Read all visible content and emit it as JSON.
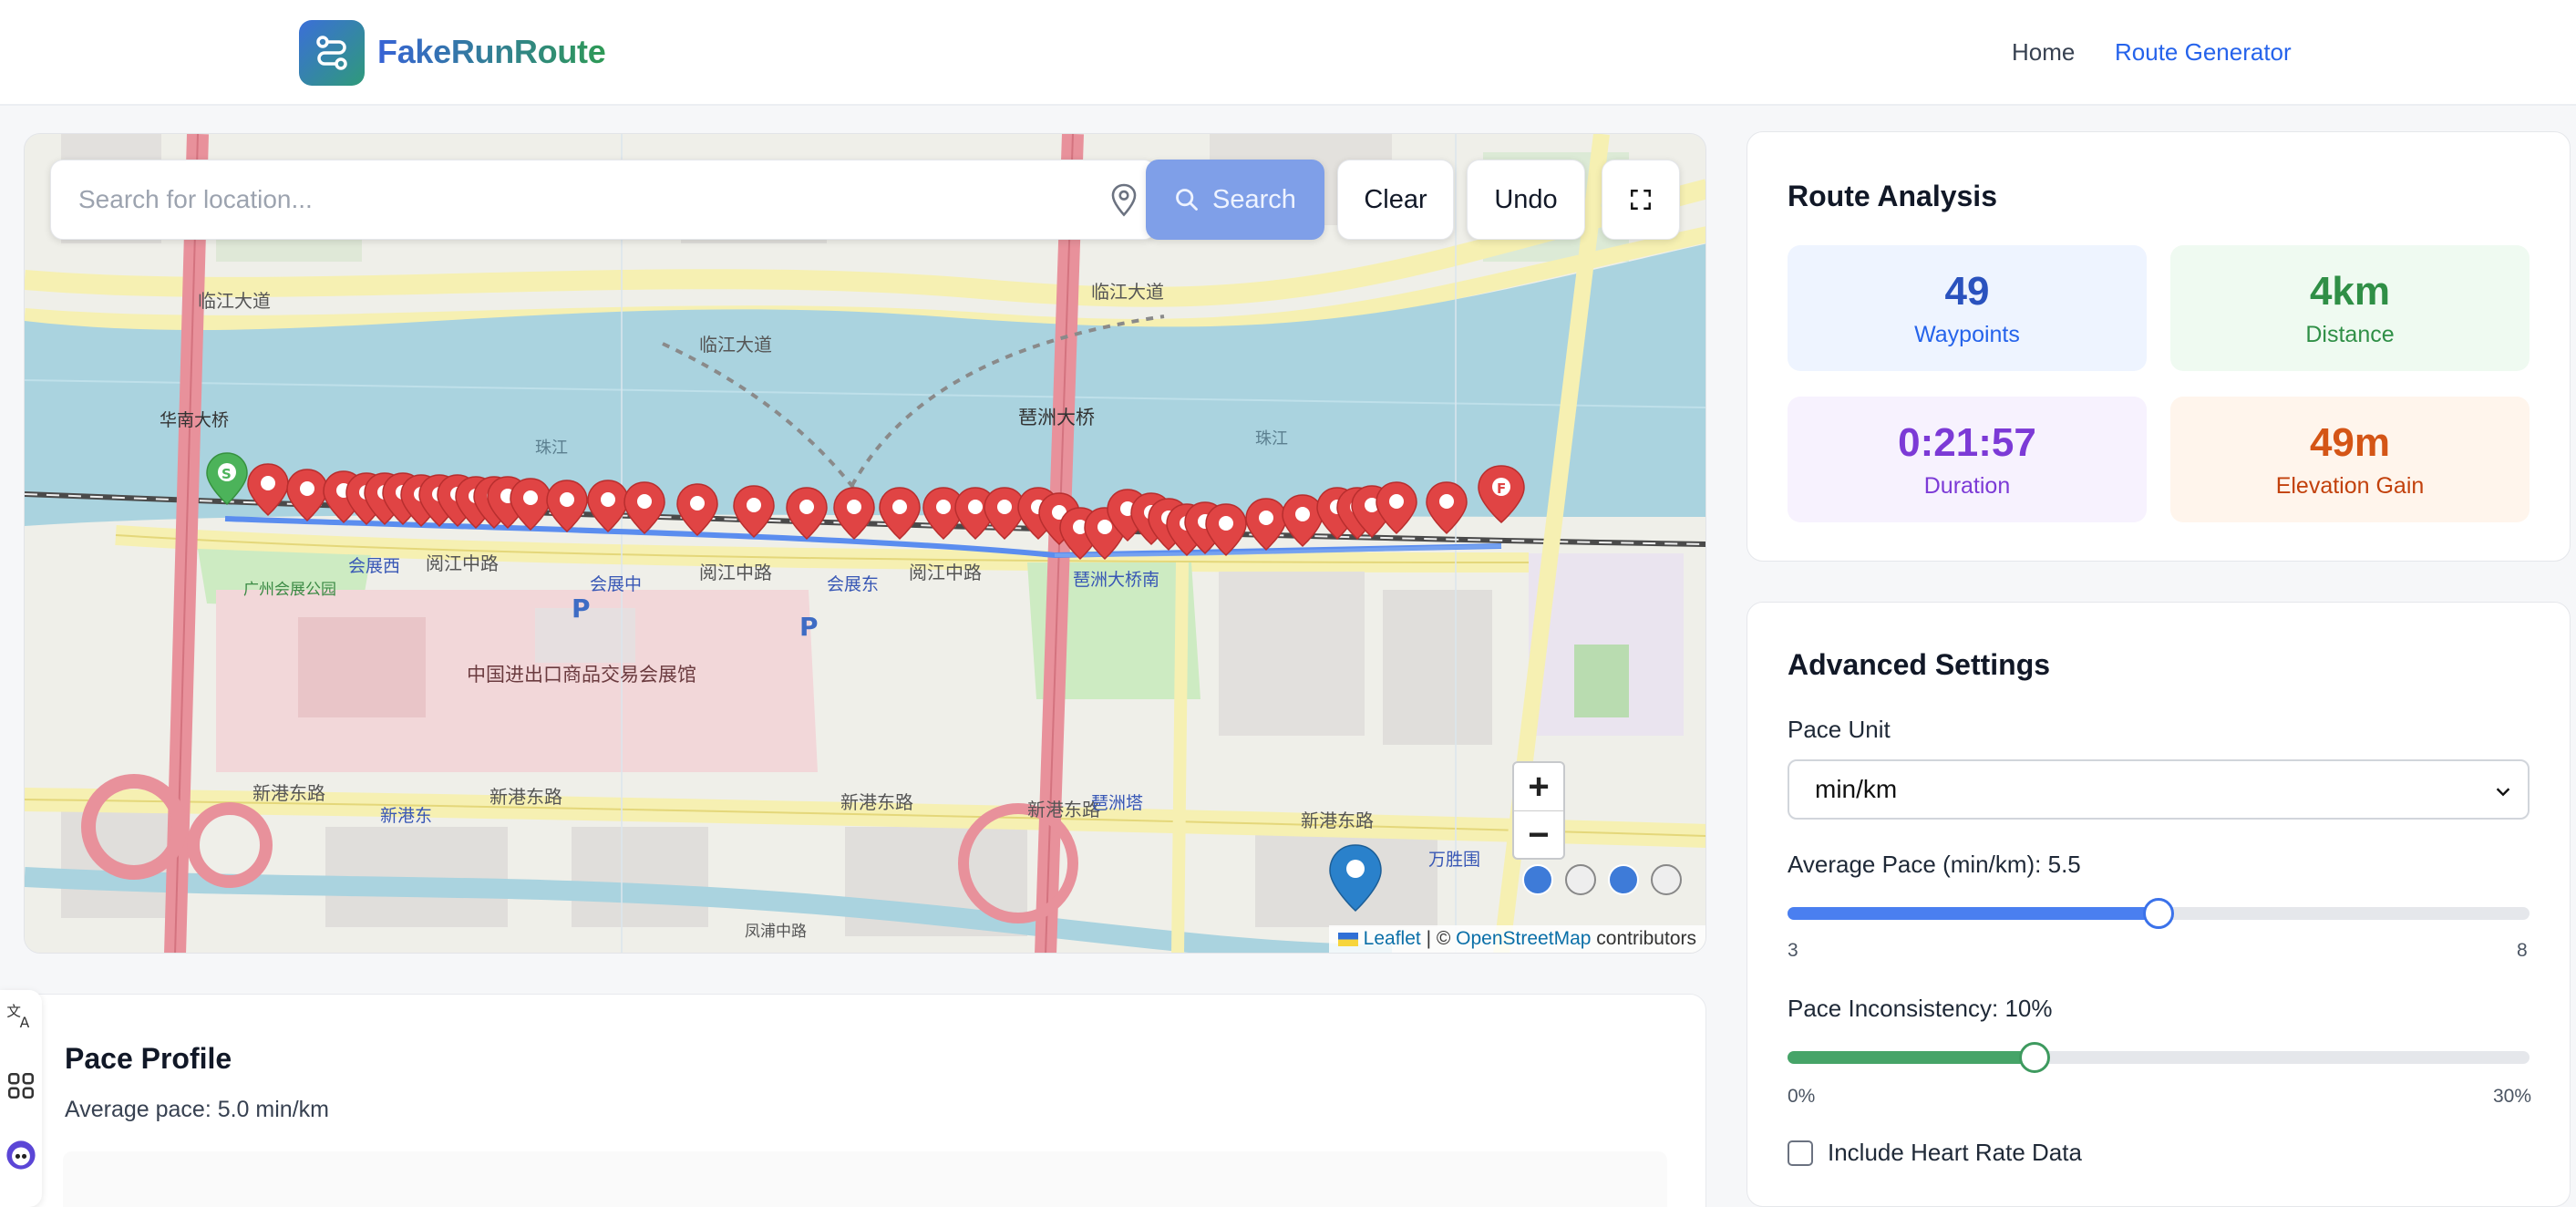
{
  "app": {
    "name": "FakeRunRoute"
  },
  "nav": {
    "home": "Home",
    "route_generator": "Route Generator"
  },
  "map": {
    "search_placeholder": "Search for location...",
    "search_button": "Search",
    "clear_button": "Clear",
    "undo_button": "Undo",
    "zoom_in": "+",
    "zoom_out": "−",
    "attribution": {
      "leaflet": "Leaflet",
      "separator": "| ©",
      "osm": "OpenStreetMap",
      "contributors": "contributors"
    },
    "labels": {
      "road_linjiang": "临江大道",
      "road_yuejiang": "阅江中路",
      "road_xingang": "新港东路",
      "river_zhujiang": "珠江",
      "bridge_pazhou": "琶洲大桥",
      "station_huizhanxi": "会展西",
      "station_huizhanzhong": "会展中",
      "station_huizhandong": "会展东",
      "station_pazhou_bridge": "琶洲大桥南",
      "canton_fair": "中国进出口商品交易会展馆",
      "park": "广州会展公园",
      "bridge_huanan": "华南大桥",
      "station_xingangdong": "新港东",
      "station_pazhouta": "琶洲塔",
      "station_wanshengwei": "万胜围",
      "road_fengpu": "凤浦中路",
      "parking": "P",
      "start_pin": "S",
      "finish_pin": "F"
    }
  },
  "route_analysis": {
    "title": "Route Analysis",
    "waypoints": {
      "value": "49",
      "label": "Waypoints"
    },
    "distance": {
      "value": "4km",
      "label": "Distance"
    },
    "duration": {
      "value": "0:21:57",
      "label": "Duration"
    },
    "elevation": {
      "value": "49m",
      "label": "Elevation Gain"
    }
  },
  "advanced_settings": {
    "title": "Advanced Settings",
    "pace_unit_label": "Pace Unit",
    "pace_unit_value": "min/km",
    "avg_pace_label": "Average Pace (min/km): 5.5",
    "avg_pace": {
      "min": "3",
      "max": "8",
      "value": 5.5
    },
    "inconsistency_label": "Pace Inconsistency: 10%",
    "inconsistency": {
      "min": "0%",
      "max": "30%",
      "value": 10
    },
    "heart_rate_label": "Include Heart Rate Data"
  },
  "pace_profile": {
    "title": "Pace Profile",
    "subtitle": "Average pace: 5.0 min/km"
  },
  "colors": {
    "accent": "#2563eb",
    "pin_red": "#e04444",
    "pin_green": "#4cb35a",
    "route_blue": "#5b8def"
  }
}
